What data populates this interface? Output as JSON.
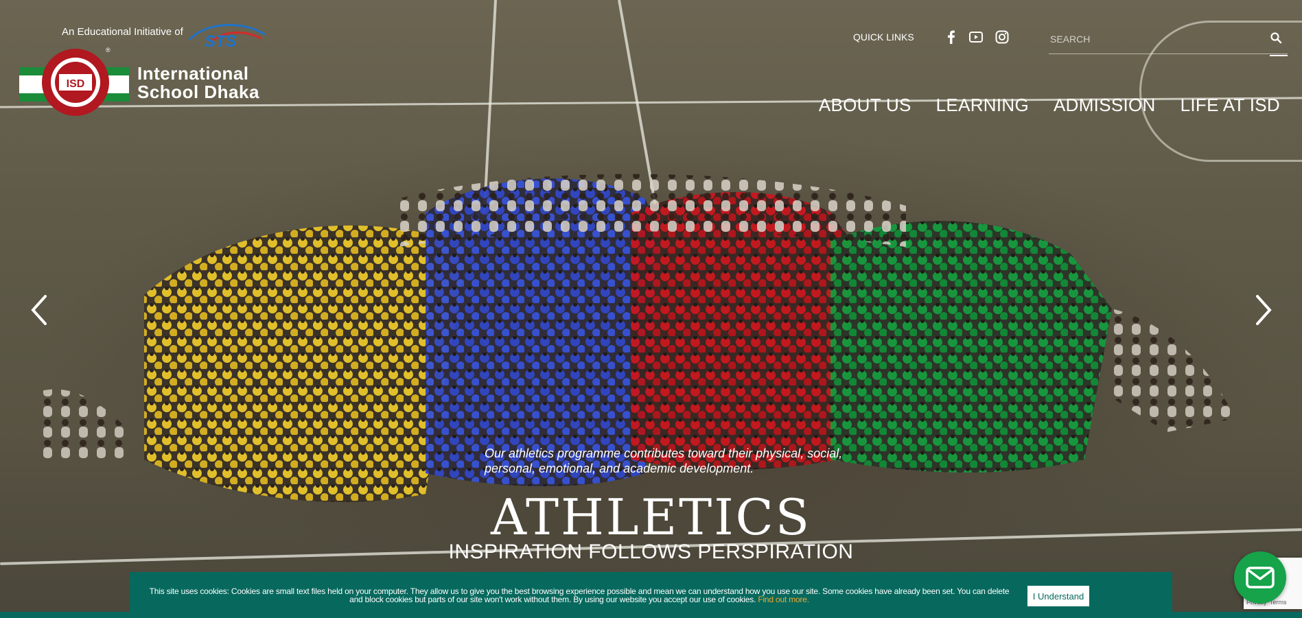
{
  "header": {
    "educational_initiative": "An Educational Initiative of",
    "school_name_line1": "International",
    "school_name_line2": "School Dhaka",
    "quick_links": "QUICK LINKS",
    "search_placeholder": "SEARCH"
  },
  "nav": {
    "items": [
      {
        "label": "ABOUT US"
      },
      {
        "label": "LEARNING"
      },
      {
        "label": "ADMISSION"
      },
      {
        "label": "LIFE AT ISD"
      }
    ]
  },
  "social": [
    "facebook-icon",
    "youtube-icon",
    "instagram-icon"
  ],
  "slide": {
    "subtitle": "Our athletics programme contributes toward their physical, social, personal, emotional, and academic development.",
    "title": "ATHLETICS",
    "tagline": "INSPIRATION FOLLOWS PERSPIRATION"
  },
  "cookie": {
    "text": "This site uses cookies: Cookies are small text files held on your computer. They allow us to give you the best browsing experience possible and mean we can understand how you use our site. Some cookies have already been set. You can delete and block cookies but parts of our site won't work without them. By using our website you accept our use of cookies.",
    "link_text": "Find out more.",
    "button_label": "I Understand"
  },
  "recaptcha": {
    "privacy": "Privacy",
    "terms": "Terms"
  },
  "colors": {
    "accent_teal": "#07695e",
    "mail_green": "#16a34a",
    "cookie_link": "#f0a830"
  }
}
